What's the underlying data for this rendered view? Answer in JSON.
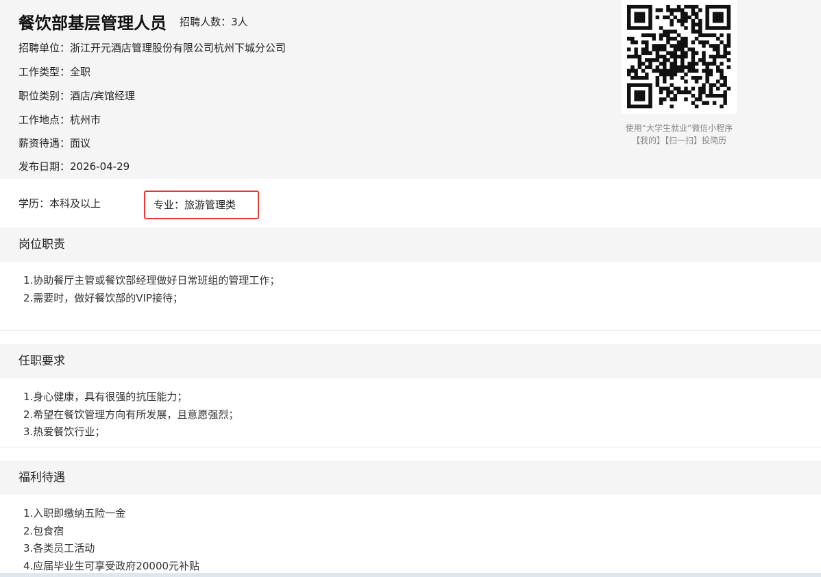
{
  "job": {
    "title": "餐饮部基层管理人员",
    "hire_count": "招聘人数：3人",
    "info": [
      "招聘单位：浙江开元酒店管理股份有限公司杭州下城分公司",
      "工作类型：全职",
      "职位类别：酒店/宾馆经理",
      "工作地点：杭州市",
      "薪资待遇：面议",
      "发布日期：2026-04-29"
    ]
  },
  "qr": {
    "caption_line1": "使用“大学生就业”微信小程序",
    "caption_line2": "【我的】【扫一扫】投简历"
  },
  "requirements": {
    "education": "学历：本科及以上",
    "major": "专业：旅游管理类",
    "highlight_color": "#e53935"
  },
  "sections": [
    {
      "heading": "岗位职责",
      "items": [
        "1.协助餐厅主管或餐饮部经理做好日常班组的管理工作；",
        "2.需要时，做好餐饮部的VIP接待；"
      ]
    },
    {
      "heading": "任职要求",
      "items": [
        "1.身心健康，具有很强的抗压能力；",
        "2.希望在餐饮管理方向有所发展，且意愿强烈；",
        "3.热爱餐饮行业；"
      ]
    },
    {
      "heading": "福利待遇",
      "items": [
        "1.入职即缴纳五险一金",
        "2.包食宿",
        "3.各类员工活动",
        "4.应届毕业生可享受政府20000元补贴"
      ]
    }
  ]
}
